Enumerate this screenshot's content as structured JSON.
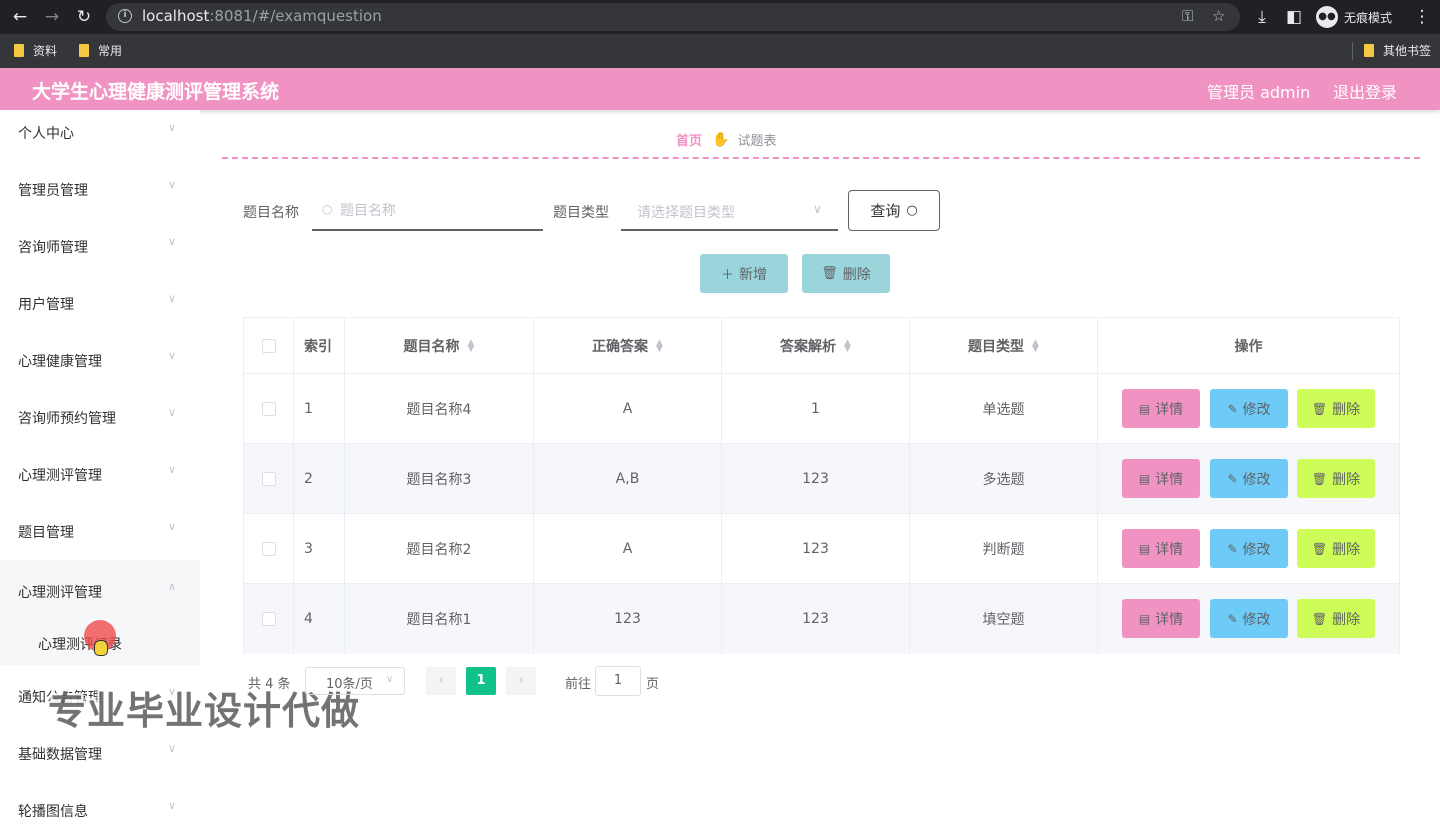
{
  "browser": {
    "url_host": "localhost",
    "url_rest": ":8081/#/examquestion",
    "incognito_label": "无痕模式",
    "bookmarks": [
      "资料",
      "常用"
    ],
    "other_bookmarks": "其他书签"
  },
  "header": {
    "title": "大学生心理健康测评管理系统",
    "user": "管理员 admin",
    "logout": "退出登录"
  },
  "sidebar": {
    "items": [
      {
        "label": "个人中心"
      },
      {
        "label": "管理员管理"
      },
      {
        "label": "咨询师管理"
      },
      {
        "label": "用户管理"
      },
      {
        "label": "心理健康管理"
      },
      {
        "label": "咨询师预约管理"
      },
      {
        "label": "心理测评管理"
      },
      {
        "label": "题目管理"
      },
      {
        "label": "心理测评管理"
      },
      {
        "label": "通知公告管理"
      },
      {
        "label": "基础数据管理"
      },
      {
        "label": "轮播图信息"
      }
    ],
    "submenu_label": "心理测评记录"
  },
  "watermark": "专业毕业设计代做",
  "breadcrumb": {
    "home": "首页",
    "current": "试题表"
  },
  "search": {
    "name_label": "题目名称",
    "name_placeholder": "题目名称",
    "type_label": "题目类型",
    "type_placeholder": "请选择题目类型",
    "query_button": "查询"
  },
  "actions": {
    "add": "新增",
    "delete": "删除"
  },
  "table": {
    "columns": [
      "索引",
      "题目名称",
      "正确答案",
      "答案解析",
      "题目类型",
      "操作"
    ],
    "rows": [
      {
        "index": "1",
        "name": "题目名称4",
        "answer": "A",
        "analysis": "1",
        "type": "单选题"
      },
      {
        "index": "2",
        "name": "题目名称3",
        "answer": "A,B",
        "analysis": "123",
        "type": "多选题"
      },
      {
        "index": "3",
        "name": "题目名称2",
        "answer": "A",
        "analysis": "123",
        "type": "判断题"
      },
      {
        "index": "4",
        "name": "题目名称1",
        "answer": "123",
        "analysis": "123",
        "type": "填空题"
      }
    ],
    "op_detail": "详情",
    "op_edit": "修改",
    "op_delete": "删除"
  },
  "pagination": {
    "total": "共 4 条",
    "page_size": "10条/页",
    "current_page": "1",
    "goto_label": "前往",
    "goto_value": "1",
    "page_suffix": "页"
  },
  "colors": {
    "header_bg": "#f093c3",
    "detail_btn": "#f093c3",
    "edit_btn": "#6ecbf7",
    "delete_btn": "#cefc59",
    "action_btn": "#9ad5dc",
    "page_active": "#10c28a"
  }
}
